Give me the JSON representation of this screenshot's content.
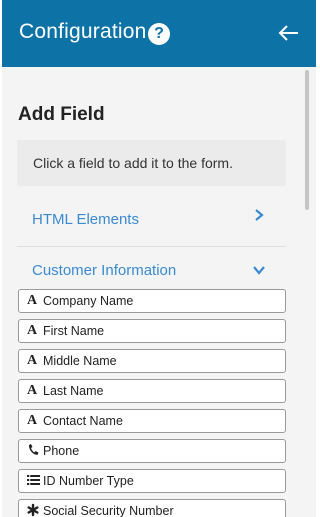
{
  "header": {
    "title": "Configuration",
    "help_icon": "question-circle-icon",
    "back_icon": "arrow-left-icon",
    "background": "#0d73a6"
  },
  "panel": {
    "section_title": "Add Field",
    "hint": "Click a field to add it to the form."
  },
  "groups": [
    {
      "label": "HTML Elements",
      "state": "collapsed",
      "icon": "chevron-right-icon"
    },
    {
      "label": "Customer Information",
      "state": "expanded",
      "icon": "chevron-down-icon"
    }
  ],
  "fields": [
    {
      "label": "Company Name",
      "icon": "text-a-icon"
    },
    {
      "label": "First Name",
      "icon": "text-a-icon"
    },
    {
      "label": "Middle Name",
      "icon": "text-a-icon"
    },
    {
      "label": "Last Name",
      "icon": "text-a-icon"
    },
    {
      "label": "Contact Name",
      "icon": "text-a-icon"
    },
    {
      "label": "Phone",
      "icon": "phone-icon"
    },
    {
      "label": "ID Number Type",
      "icon": "list-icon"
    },
    {
      "label": "Social Security Number",
      "icon": "asterisk-icon"
    }
  ],
  "colors": {
    "accent_link": "#3a8ad1",
    "panel_bg": "#f4f4f4"
  }
}
